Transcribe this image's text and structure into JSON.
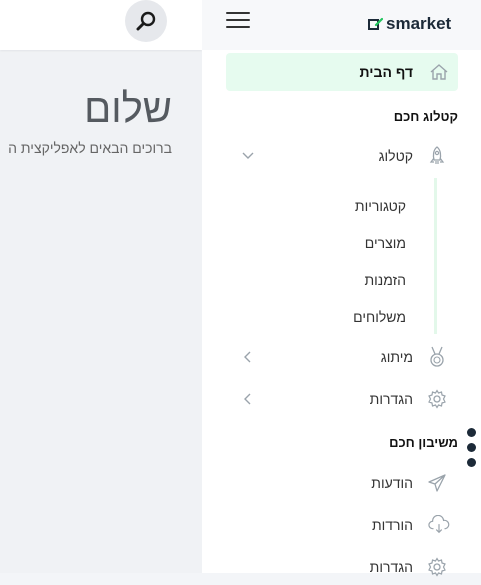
{
  "main": {
    "greeting_title": "שלום",
    "greeting_subtitle": "ברוכים הבאים לאפליקצית ה"
  },
  "header": {
    "logo_text": "smarket",
    "search_icon": "search-icon",
    "menu_icon": "hamburger-icon"
  },
  "sidebar": {
    "home_label": "דף הבית",
    "section_catalog": "קטלוג חכם",
    "catalog_label": "קטלוג",
    "catalog_subitems": [
      "קטגוריות",
      "מוצרים",
      "הזמנות",
      "משלוחים"
    ],
    "branding_label": "מיתוג",
    "settings_label": "הגדרות",
    "section_messaging": "משיבון חכם",
    "messages_label": "הודעות",
    "downloads_label": "הורדות",
    "messaging_settings_label": "הגדרות"
  },
  "colors": {
    "accent": "#22c55e",
    "active_bg": "#e6fbef",
    "dark": "#1c2a38"
  }
}
